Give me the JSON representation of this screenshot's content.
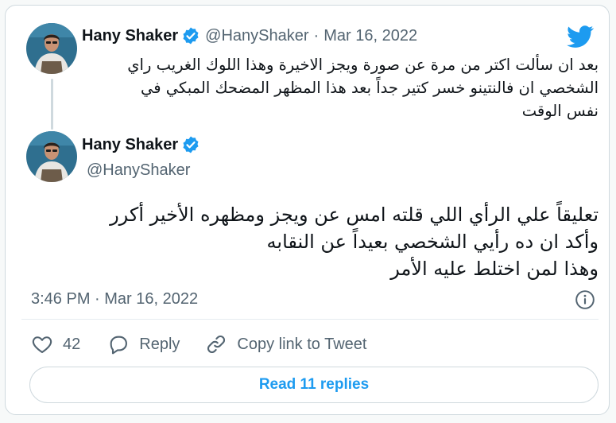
{
  "quoted_tweet": {
    "author_name": "Hany Shaker",
    "handle": "@HanyShaker",
    "separator": "·",
    "date": "Mar 16, 2022",
    "lines": [
      "بعد ان سألت اكتر من مرة عن صورة ويجز الاخيرة وهذا اللوك الغريب راي",
      "الشخصي ان فالنتينو خسر كتير جداً بعد هذا المظهر المضحك المبكي في",
      "نفس الوقت"
    ]
  },
  "main_tweet": {
    "author_name": "Hany Shaker",
    "handle": "@HanyShaker",
    "lines": [
      "تعليقاً علي الرأي اللي قلته امس عن ويجز ومظهره الأخير أكرر",
      "وأكد ان ده رأيي الشخصي بعيداً عن النقابه",
      "وهذا لمن اختلط عليه الأمر"
    ],
    "timestamp": "3:46 PM · Mar 16, 2022"
  },
  "actions": {
    "like_count": "42",
    "reply_label": "Reply",
    "copy_label": "Copy link to Tweet"
  },
  "read_replies_label": "Read 11 replies",
  "colors": {
    "brand_blue": "#1d9bf0",
    "text_primary": "#0f1419",
    "text_secondary": "#536471",
    "border": "#cfd9de"
  },
  "icons": [
    "twitter-logo-icon",
    "verified-badge-icon",
    "info-icon",
    "heart-icon",
    "reply-icon",
    "link-icon"
  ]
}
